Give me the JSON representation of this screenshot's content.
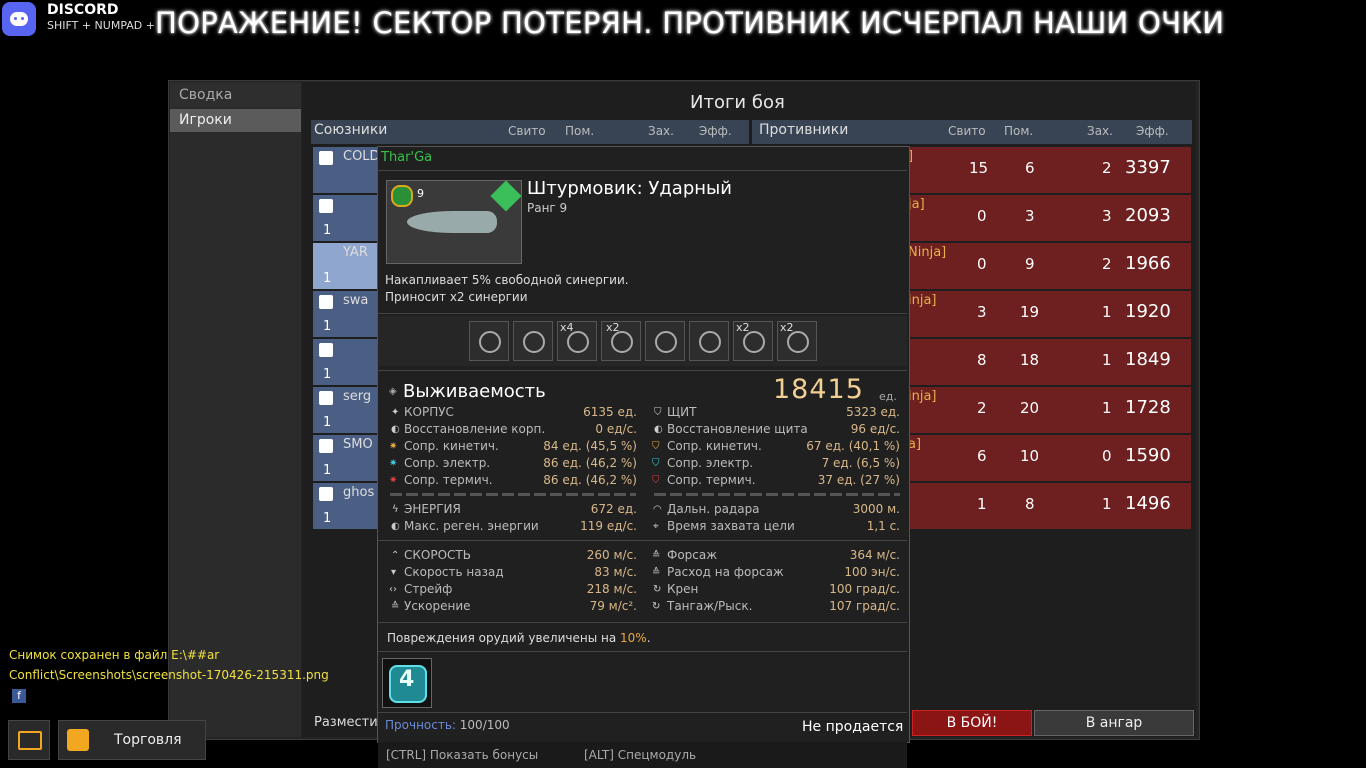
{
  "overlay": {
    "discord_name": "DISCORD",
    "discord_hint": "SHIFT + NUMPAD +",
    "banner": "ПОРАЖЕНИЕ! СЕКТОР ПОТЕРЯН. ПРОТИВНИК ИСЧЕРПАЛ НАШИ ОЧКИ"
  },
  "nav": {
    "summary": "Сводка",
    "players": "Игроки"
  },
  "battle": {
    "title": "Итоги боя",
    "allies_header": {
      "label": "Союзники",
      "kills": "Свито",
      "assists": "Пом.",
      "caps": "Зах.",
      "eff": "Эфф."
    },
    "enemies_header": {
      "label": "Противники",
      "kills": "Свито",
      "assists": "Пом.",
      "caps": "Зах.",
      "eff": "Эфф."
    },
    "allies": [
      {
        "name": "COLD",
        "num": ""
      },
      {
        "name": "",
        "num": "1"
      },
      {
        "name": "YAR",
        "num": "1"
      },
      {
        "name": "swa",
        "num": "1"
      },
      {
        "name": "",
        "num": "1"
      },
      {
        "name": "serg",
        "num": "1"
      },
      {
        "name": "SMO",
        "num": "1"
      },
      {
        "name": "ghos",
        "num": "1"
      }
    ],
    "enemies": [
      {
        "tag": "]",
        "kills": "15",
        "assists": "6",
        "caps": "2",
        "eff": "3397"
      },
      {
        "tag": "ja]",
        "kills": "0",
        "assists": "3",
        "caps": "3",
        "eff": "2093"
      },
      {
        "tag": "Ninja]",
        "kills": "0",
        "assists": "9",
        "caps": "2",
        "eff": "1966"
      },
      {
        "tag": "inja]",
        "kills": "3",
        "assists": "19",
        "caps": "1",
        "eff": "1920"
      },
      {
        "tag": "",
        "kills": "8",
        "assists": "18",
        "caps": "1",
        "eff": "1849"
      },
      {
        "tag": "inja]",
        "kills": "2",
        "assists": "20",
        "caps": "1",
        "eff": "1728"
      },
      {
        "tag": "a]",
        "kills": "6",
        "assists": "10",
        "caps": "0",
        "eff": "1590"
      },
      {
        "tag": "",
        "kills": "1",
        "assists": "8",
        "caps": "1",
        "eff": "1496"
      }
    ],
    "placement_label": "Разместит",
    "battle_btn": "В БОЙ!",
    "hangar_btn": "В ангар"
  },
  "tooltip": {
    "owner": "Thar'Ga",
    "ship_rank_badge": "9",
    "ship_title": "Штурмовик: Ударный",
    "ship_rank": "Ранг 9",
    "desc1": "Накапливает 5% свободной синергии.",
    "desc2": "Приносит x2 синергии",
    "modules": [
      {
        "icon": "crosshair-icon",
        "mult": ""
      },
      {
        "icon": "missile-icon",
        "mult": ""
      },
      {
        "icon": "gear-icon",
        "mult": "x4"
      },
      {
        "icon": "arrow-up-icon",
        "mult": ""
      },
      {
        "icon": "lightning-icon",
        "mult": "x2"
      },
      {
        "icon": "shield-icon",
        "mult": ""
      },
      {
        "icon": "plus-icon",
        "mult": "x2"
      },
      {
        "icon": "target-icon",
        "mult": "x2"
      }
    ],
    "survivability_label": "Выживаемость",
    "survivability_value": "18415",
    "survivability_unit": "ед.",
    "stats_left": [
      {
        "label": "КОРПУС",
        "value": "6135 ед."
      },
      {
        "label": "Восстановление корп.",
        "value": "0 ед/с."
      },
      {
        "label": "Сопр. кинетич.",
        "value": "84 ед. (45,5 %)"
      },
      {
        "label": "Сопр. электр.",
        "value": "86 ед. (46,2 %)"
      },
      {
        "label": "Сопр. термич.",
        "value": "86 ед. (46,2 %)"
      },
      {
        "label": "ЭНЕРГИЯ",
        "value": "672 ед."
      },
      {
        "label": "Макс. реген. энергии",
        "value": "119 ед/с."
      },
      {
        "label": "СКОРОСТЬ",
        "value": "260 м/с."
      },
      {
        "label": "Скорость назад",
        "value": "83 м/с."
      },
      {
        "label": "Стрейф",
        "value": "218 м/с."
      },
      {
        "label": "Ускорение",
        "value": "79 м/с²."
      }
    ],
    "stats_right": [
      {
        "label": "ЩИТ",
        "value": "5323 ед."
      },
      {
        "label": "Восстановление щита",
        "value": "96 ед/с."
      },
      {
        "label": "Сопр. кинетич.",
        "value": "67 ед. (40,1 %)"
      },
      {
        "label": "Сопр. электр.",
        "value": "7 ед. (6,5 %)"
      },
      {
        "label": "Сопр. термич.",
        "value": "37 ед. (27 %)"
      },
      {
        "label": "Дальн. радара",
        "value": "3000 м."
      },
      {
        "label": "Время захвата цели",
        "value": "1,1 с."
      },
      {
        "label": "Форсаж",
        "value": "364 м/с."
      },
      {
        "label": "Расход на форсаж",
        "value": "100 эн/с."
      },
      {
        "label": "Крен",
        "value": "100 град/с."
      },
      {
        "label": "Тангаж/Рыск.",
        "value": "107 град/с."
      }
    ],
    "bonus_text": "Повреждения орудий увеличены на ",
    "bonus_pct": "10%",
    "bonus_end": ".",
    "special_digit": "4",
    "durability_label": "Прочность:",
    "durability_value": " 100/100",
    "not_sold": "Не продается",
    "hint_ctrl": "[CTRL] Показать бонусы",
    "hint_alt": "[ALT] Спецмодуль"
  },
  "notice": {
    "line": "Снимок сохранен в файл E:\\##ar Conflict\\Screenshots\\screenshot-170426-215311.png",
    "fb": "f"
  },
  "bottom": {
    "trade": "Торговля"
  },
  "colors": {
    "accent": "#f2cf93",
    "enemy_row": "#6e1f1f",
    "ally_row": "#4b5f85",
    "owner_green": "#36c24a"
  }
}
